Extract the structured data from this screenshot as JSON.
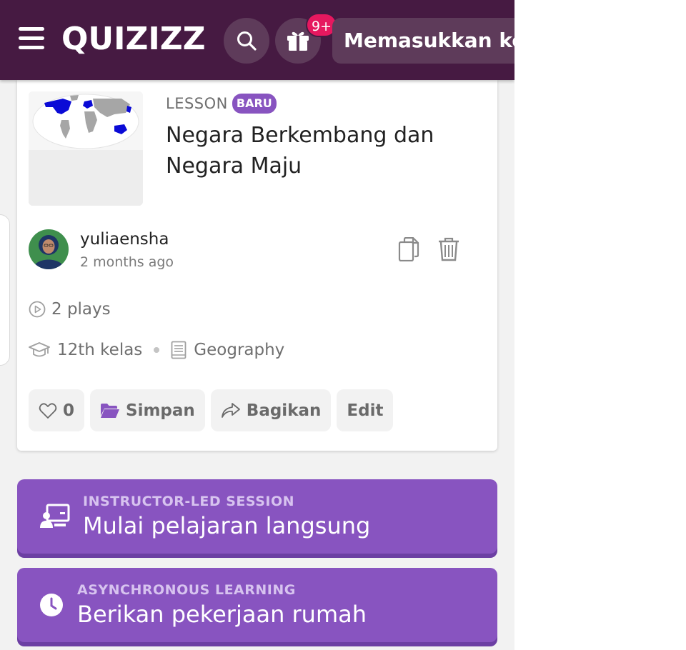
{
  "header": {
    "logo_text": "QUIZIZZ",
    "notification_count": "9+",
    "join_code_placeholder": "Memasukkan kode"
  },
  "lesson": {
    "type_label": "LESSON",
    "badge": "BARU",
    "title": "Negara Berkembang dan Negara Maju",
    "author": "yuliaensha",
    "time_ago": "2 months ago",
    "plays": "2 plays",
    "grade": "12th kelas",
    "subject": "Geography"
  },
  "actions": {
    "likes": "0",
    "save_label": "Simpan",
    "share_label": "Bagikan",
    "edit_label": "Edit"
  },
  "sessions": [
    {
      "kicker": "INSTRUCTOR-LED SESSION",
      "title": "Mulai pelajaran langsung"
    },
    {
      "kicker": "ASYNCHRONOUS LEARNING",
      "title": "Berikan pekerjaan rumah"
    }
  ],
  "colors": {
    "header_bg": "#461a42",
    "accent_purple": "#8854c0",
    "badge_red": "#e6185f"
  },
  "icons": [
    "hamburger-icon",
    "search-icon",
    "gift-icon",
    "copy-icon",
    "trash-icon",
    "play-icon",
    "graduation-cap-icon",
    "book-icon",
    "heart-icon",
    "folder-icon",
    "share-icon",
    "presentation-icon",
    "clock-icon"
  ]
}
